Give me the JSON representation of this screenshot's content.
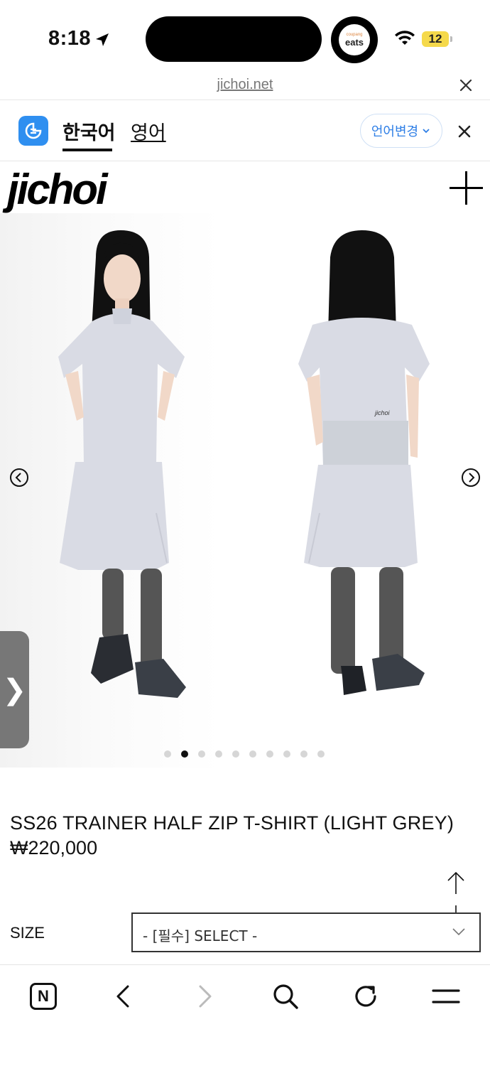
{
  "status_bar": {
    "time": "8:18",
    "app_badge_top": "coupang",
    "app_badge_bottom": "eats",
    "battery_level": "12"
  },
  "browser": {
    "url": "jichoi.net"
  },
  "translate_bar": {
    "source_lang": "한국어",
    "target_lang": "영어",
    "change_label": "언어변경"
  },
  "site": {
    "logo": "jichoi"
  },
  "gallery": {
    "slide_count": 10,
    "active_index": 1
  },
  "product": {
    "name": "SS26 TRAINER HALF ZIP T-SHIRT (LIGHT GREY)",
    "price": "₩220,000",
    "size_label": "SIZE",
    "size_select_value": "- [필수] SELECT -"
  },
  "colors": {
    "accent_blue": "#2f7fe6",
    "papago_blue": "#2f8ff0",
    "battery": "#f5d94b",
    "garment": "#d9dbe4",
    "socks": "#555555"
  }
}
